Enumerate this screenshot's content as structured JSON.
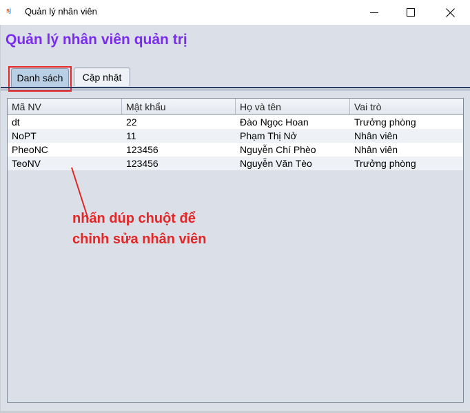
{
  "window": {
    "logo_s": "s",
    "logo_j": "j",
    "title": "Quản lý nhân viên"
  },
  "heading": "Quản lý nhân viên quản trị",
  "tabs": [
    {
      "label": "Danh sách",
      "active": true
    },
    {
      "label": "Cập nhật",
      "active": false
    }
  ],
  "table": {
    "columns": [
      "Mã NV",
      "Mật khẩu",
      "Họ và tên",
      "Vai trò"
    ],
    "rows": [
      [
        "dt",
        "22",
        "Đào Ngọc Hoan",
        "Trưởng phòng"
      ],
      [
        "NoPT",
        "11",
        "Phạm Thị Nở",
        "Nhân viên"
      ],
      [
        "PheoNC",
        "123456",
        "Nguyễn Chí Phèo",
        "Nhân viên"
      ],
      [
        "TeoNV",
        "123456",
        "Nguyễn Văn Tèo",
        "Trưởng phòng"
      ]
    ]
  },
  "annotation": {
    "text": "nhấn dúp chuột để chỉnh sửa nhân viên",
    "color": "#e32626"
  },
  "colors": {
    "heading": "#7a2cf0",
    "active_tab": "#b8cfe5",
    "panel_bg": "#dadfe8"
  },
  "icons": {
    "minimize": "minimize-icon",
    "maximize": "maximize-icon",
    "close": "close-icon"
  }
}
